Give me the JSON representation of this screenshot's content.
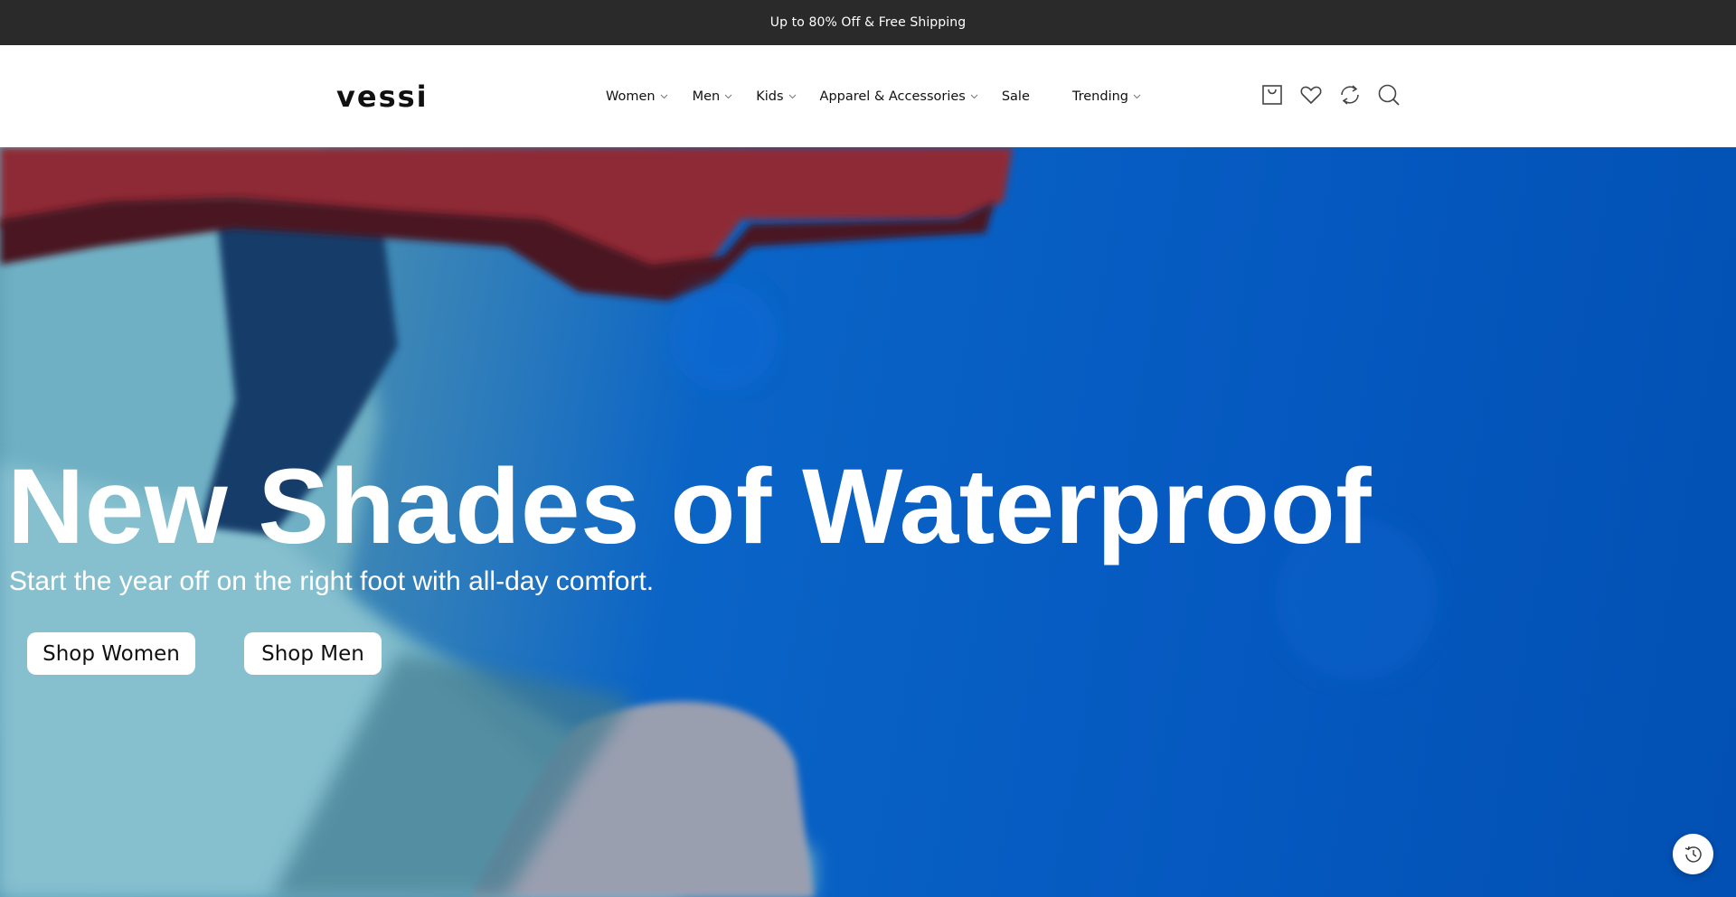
{
  "announcement": {
    "text": "Up to 80% Off & Free Shipping"
  },
  "header": {
    "logo_text": "vessi",
    "nav": [
      {
        "label": "Women",
        "has_dropdown": true
      },
      {
        "label": "Men",
        "has_dropdown": true
      },
      {
        "label": "Kids",
        "has_dropdown": true
      },
      {
        "label": "Apparel & Accessories",
        "has_dropdown": true
      },
      {
        "label": "Sale",
        "has_dropdown": false
      },
      {
        "label": "Trending",
        "has_dropdown": true
      }
    ],
    "icons": [
      "cart-icon",
      "heart-icon",
      "refresh-icon",
      "search-icon"
    ]
  },
  "hero": {
    "title": "New Shades of Waterproof",
    "subtitle": "Start the year off on the right foot with all-day comfort.",
    "buttons": {
      "women": "Shop Women",
      "men": "Shop Men"
    }
  },
  "floating": {
    "icon": "history-clock-icon"
  },
  "colors": {
    "announcement_bg": "#2a2a2a",
    "hero_blue": "#0559c0",
    "cap_red": "#8e2a35",
    "text_white": "#ffffff"
  }
}
